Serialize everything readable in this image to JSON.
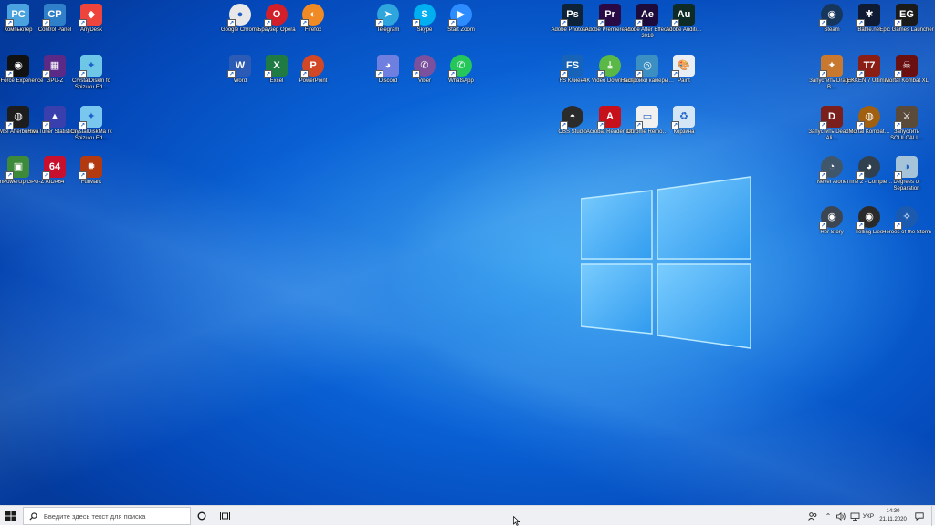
{
  "desktop": {
    "icons": [
      {
        "name": "this-pc-icon",
        "label": "Компьютер",
        "bg": "#4aa3df",
        "glyph": "PC",
        "round": false
      },
      {
        "name": "control-panel-icon",
        "label": "Control Panel",
        "bg": "#2f7fc9",
        "glyph": "CP",
        "round": false
      },
      {
        "name": "anydesk-icon",
        "label": "AnyDesk",
        "bg": "#ef443b",
        "glyph": "◆",
        "round": false
      },
      {
        "name": "geforce-experience-icon",
        "label": "GeForce Experience",
        "bg": "#111111",
        "glyph": "◉",
        "round": false
      },
      {
        "name": "gpu-z-icon",
        "label": "GPU-Z",
        "bg": "#5b2a86",
        "glyph": "▦",
        "round": false
      },
      {
        "name": "crystaldiskinfo-icon",
        "label": "CrystalDiskIn fo Shizuku Ed…",
        "bg": "#6fc7e8",
        "glyph": "✦",
        "round": false
      },
      {
        "name": "msi-afterburner-icon",
        "label": "MSI Afterburner",
        "bg": "#1d1d1d",
        "glyph": "◍",
        "round": false
      },
      {
        "name": "rivatuner-icon",
        "label": "RivaTuner Statistics…",
        "bg": "#3a3fae",
        "glyph": "▲",
        "round": false
      },
      {
        "name": "crystaldiskmark-icon",
        "label": "CrystalDiskMa rk Shizuku Ed…",
        "bg": "#79c6ef",
        "glyph": "✦",
        "round": false
      },
      {
        "name": "techpowerup-gpuz-icon",
        "label": "techPowerUp GPU-Z",
        "bg": "#3d8a3a",
        "glyph": "▣",
        "round": false
      },
      {
        "name": "aida64-icon",
        "label": "AIDA64",
        "bg": "#c8102e",
        "glyph": "64",
        "round": false
      },
      {
        "name": "furmark-icon",
        "label": "FurMark",
        "bg": "#b33a10",
        "glyph": "✹",
        "round": false
      },
      {
        "name": "google-chrome-icon",
        "label": "Google Chrome",
        "bg": "#e8e8e8",
        "glyph": "●",
        "round": true
      },
      {
        "name": "opera-icon",
        "label": "Браузер Opera",
        "bg": "#d21f2a",
        "glyph": "O",
        "round": true
      },
      {
        "name": "firefox-icon",
        "label": "Firefox",
        "bg": "#f08a24",
        "glyph": "◐",
        "round": true
      },
      {
        "name": "word-icon",
        "label": "Word",
        "bg": "#2b5bb5",
        "glyph": "W",
        "round": false
      },
      {
        "name": "excel-icon",
        "label": "Excel",
        "bg": "#1f7a43",
        "glyph": "X",
        "round": false
      },
      {
        "name": "powerpoint-icon",
        "label": "PowerPoint",
        "bg": "#d24726",
        "glyph": "P",
        "round": true
      },
      {
        "name": "telegram-icon",
        "label": "Telegram",
        "bg": "#2ea5dd",
        "glyph": "➤",
        "round": true
      },
      {
        "name": "skype-icon",
        "label": "Skype",
        "bg": "#00aff0",
        "glyph": "S",
        "round": true
      },
      {
        "name": "zoom-icon",
        "label": "Start Zoom",
        "bg": "#2d8cff",
        "glyph": "▶",
        "round": true
      },
      {
        "name": "discord-icon",
        "label": "Discord",
        "bg": "#6f7fe0",
        "glyph": "◕",
        "round": false
      },
      {
        "name": "viber-icon",
        "label": "Viber",
        "bg": "#7b519d",
        "glyph": "✆",
        "round": true
      },
      {
        "name": "whatsapp-icon",
        "label": "WhatsApp",
        "bg": "#25c75a",
        "glyph": "✆",
        "round": true
      },
      {
        "name": "photoshop-icon",
        "label": "Adobe Photosh…",
        "bg": "#0e2338",
        "glyph": "Ps",
        "round": false
      },
      {
        "name": "premiere-icon",
        "label": "Adobe Premiere P…",
        "bg": "#2a0a45",
        "glyph": "Pr",
        "round": false
      },
      {
        "name": "after-effects-icon",
        "label": "Adobe After Effects 2019",
        "bg": "#1d0c3b",
        "glyph": "Ae",
        "round": false
      },
      {
        "name": "audition-icon",
        "label": "Adobe Auditi…",
        "bg": "#0f2b26",
        "glyph": "Au",
        "round": false
      },
      {
        "name": "fs-client-icon",
        "label": "FS Клиент",
        "bg": "#1763b8",
        "glyph": "FS",
        "round": false
      },
      {
        "name": "4k-video-downloader-icon",
        "label": "4K Video Downloader",
        "bg": "#5ab946",
        "glyph": "⤓",
        "round": true
      },
      {
        "name": "camera-settings-icon",
        "label": "Настройки камеры…",
        "bg": "#3b8fc2",
        "glyph": "◎",
        "round": false
      },
      {
        "name": "paint-icon",
        "label": "Paint",
        "bg": "#e9eef5",
        "glyph": "🎨",
        "round": false
      },
      {
        "name": "obs-studio-icon",
        "label": "OBS Studio",
        "bg": "#2b2b2b",
        "glyph": "◓",
        "round": true
      },
      {
        "name": "acrobat-reader-icon",
        "label": "Acrobat Reader DC",
        "bg": "#c7101a",
        "glyph": "A",
        "round": false
      },
      {
        "name": "chrome-remote-icon",
        "label": "Chrome Remo…",
        "bg": "#f0f0f0",
        "glyph": "▭",
        "round": false
      },
      {
        "name": "recycle-bin-icon",
        "label": "Корзина",
        "bg": "#d3e6f5",
        "glyph": "♻",
        "round": false
      },
      {
        "name": "steam-icon",
        "label": "Steam",
        "bg": "#16365c",
        "glyph": "◉",
        "round": true
      },
      {
        "name": "battlenet-icon",
        "label": "Battle.net",
        "bg": "#0f1b33",
        "glyph": "✱",
        "round": false
      },
      {
        "name": "epic-games-icon",
        "label": "Epic Games Launcher",
        "bg": "#1a1a1a",
        "glyph": "EG",
        "round": false
      },
      {
        "name": "dragon-ball-icon",
        "label": "Запустить Dragon B…",
        "bg": "#c9782f",
        "glyph": "✦",
        "round": false
      },
      {
        "name": "tekken-icon",
        "label": "TEKKEN 7 Ultimat…",
        "bg": "#8a1d14",
        "glyph": "T7",
        "round": false
      },
      {
        "name": "mortal-kombat-xl-icon",
        "label": "Mortal Kombat XL",
        "bg": "#6b1010",
        "glyph": "☠",
        "round": false
      },
      {
        "name": "dead-or-alive-icon",
        "label": "Запустить Dead or Ali…",
        "bg": "#7a1f1c",
        "glyph": "D",
        "round": false
      },
      {
        "name": "mortal-kombat-icon",
        "label": "Mortal Kombat…",
        "bg": "#a06010",
        "glyph": "◍",
        "round": true
      },
      {
        "name": "soulcalibur-icon",
        "label": "Запустить SOULCALI…",
        "bg": "#5a4a3a",
        "glyph": "⚔",
        "round": false
      },
      {
        "name": "never-alone-icon",
        "label": "Never Alone",
        "bg": "#40566b",
        "glyph": "◔",
        "round": true
      },
      {
        "name": "trine-icon",
        "label": "Trine 2 - Comple…",
        "bg": "#30404e",
        "glyph": "◕",
        "round": true
      },
      {
        "name": "degrees-of-separation-icon",
        "label": "Degrees of Separation",
        "bg": "#a6c4d9",
        "glyph": "◑",
        "round": false
      },
      {
        "name": "her-story-icon",
        "label": "Her Story",
        "bg": "#3c4652",
        "glyph": "◉",
        "round": true
      },
      {
        "name": "telling-lies-icon",
        "label": "Telling Lies",
        "bg": "#2a2a2a",
        "glyph": "◉",
        "round": true
      },
      {
        "name": "heroes-of-the-storm-icon",
        "label": "Heroes of the Storm",
        "bg": "#1c5ab0",
        "glyph": "✧",
        "round": true
      }
    ]
  },
  "taskbar": {
    "search_placeholder": "Введите здесь текст для поиска",
    "lang": "УКР",
    "time": "14:30",
    "date": "21.11.2020"
  }
}
